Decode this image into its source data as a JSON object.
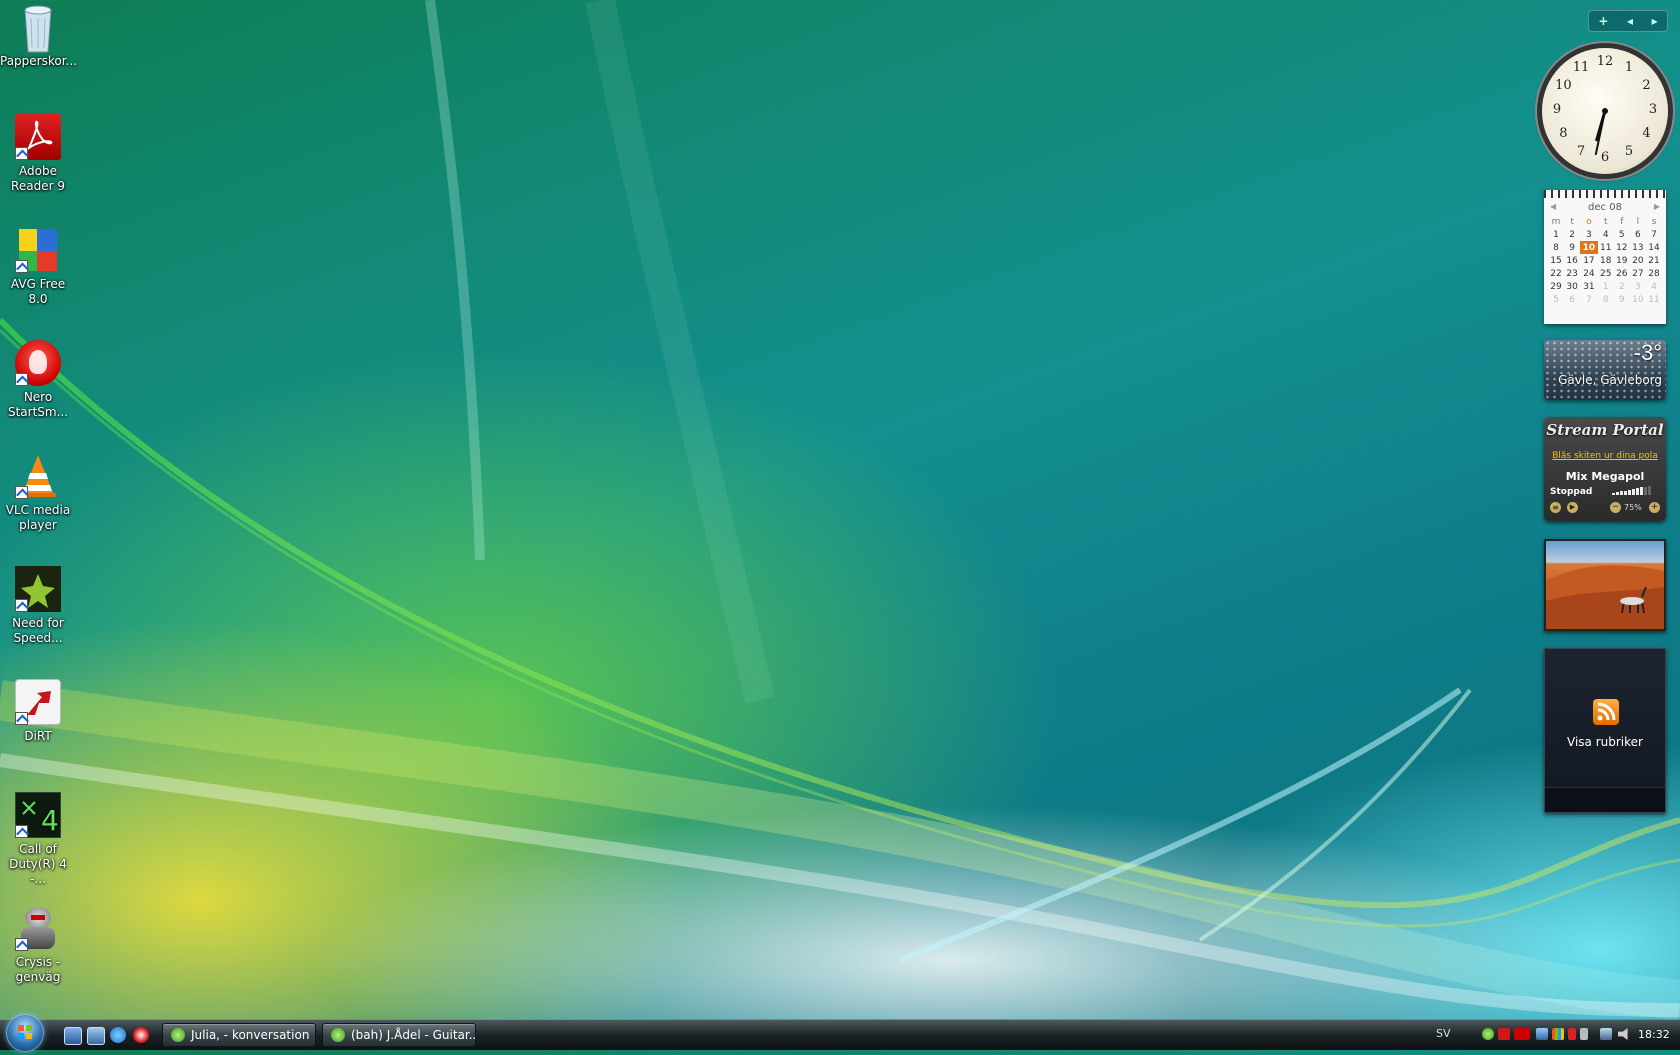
{
  "desktop_icons": [
    {
      "label": "Papperskor...",
      "icon": "recycle-bin-icon"
    },
    {
      "label": "Adobe Reader 9",
      "icon": "adobe-reader-icon"
    },
    {
      "label": "AVG Free 8.0",
      "icon": "avg-icon"
    },
    {
      "label": "Nero StartSm...",
      "icon": "nero-icon"
    },
    {
      "label": "VLC media player",
      "icon": "vlc-icon"
    },
    {
      "label": "Need for Speed...",
      "icon": "need-for-speed-icon"
    },
    {
      "label": "DiRT",
      "icon": "dirt-icon"
    },
    {
      "label": "Call of Duty(R) 4 -...",
      "icon": "call-of-duty-icon"
    },
    {
      "label": "Crysis - genväg",
      "icon": "crysis-icon"
    }
  ],
  "sidebar": {
    "add_label": "+",
    "prev_label": "◂",
    "next_label": "▸"
  },
  "clock": {
    "numbers": [
      "12",
      "1",
      "2",
      "3",
      "4",
      "5",
      "6",
      "7",
      "8",
      "9",
      "10",
      "11"
    ],
    "hour": 6,
    "minute": 32
  },
  "calendar": {
    "month_label": "dec 08",
    "prev": "◀",
    "next": "▶",
    "day_headers": [
      "m",
      "t",
      "o",
      "t",
      "f",
      "l",
      "s"
    ],
    "weeks": [
      [
        "1",
        "2",
        "3",
        "4",
        "5",
        "6",
        "7"
      ],
      [
        "8",
        "9",
        "10",
        "11",
        "12",
        "13",
        "14"
      ],
      [
        "15",
        "16",
        "17",
        "18",
        "19",
        "20",
        "21"
      ],
      [
        "22",
        "23",
        "24",
        "25",
        "26",
        "27",
        "28"
      ],
      [
        "29",
        "30",
        "31",
        "1",
        "2",
        "3",
        "4"
      ],
      [
        "5",
        "6",
        "7",
        "8",
        "9",
        "10",
        "11"
      ]
    ],
    "today": "10"
  },
  "weather": {
    "temperature": "-3°",
    "location": "Gävle, Gävleborg"
  },
  "stream_portal": {
    "title": "Stream Portal",
    "tagline": "Blås skiten ur dina pola",
    "station": "Mix Megapol",
    "status": "Stoppad",
    "volume": "75%",
    "volume_level": 0.75,
    "menu_btn": "≡",
    "play_btn": "▶",
    "minus_btn": "−",
    "plus_btn": "+"
  },
  "feed": {
    "label": "Visa rubriker"
  },
  "taskbar": {
    "tasks": [
      {
        "label": "Julia, - konversation"
      },
      {
        "label": "(bah) J.Ådel - Guitar..."
      }
    ],
    "language": "SV",
    "time": "18:32"
  }
}
